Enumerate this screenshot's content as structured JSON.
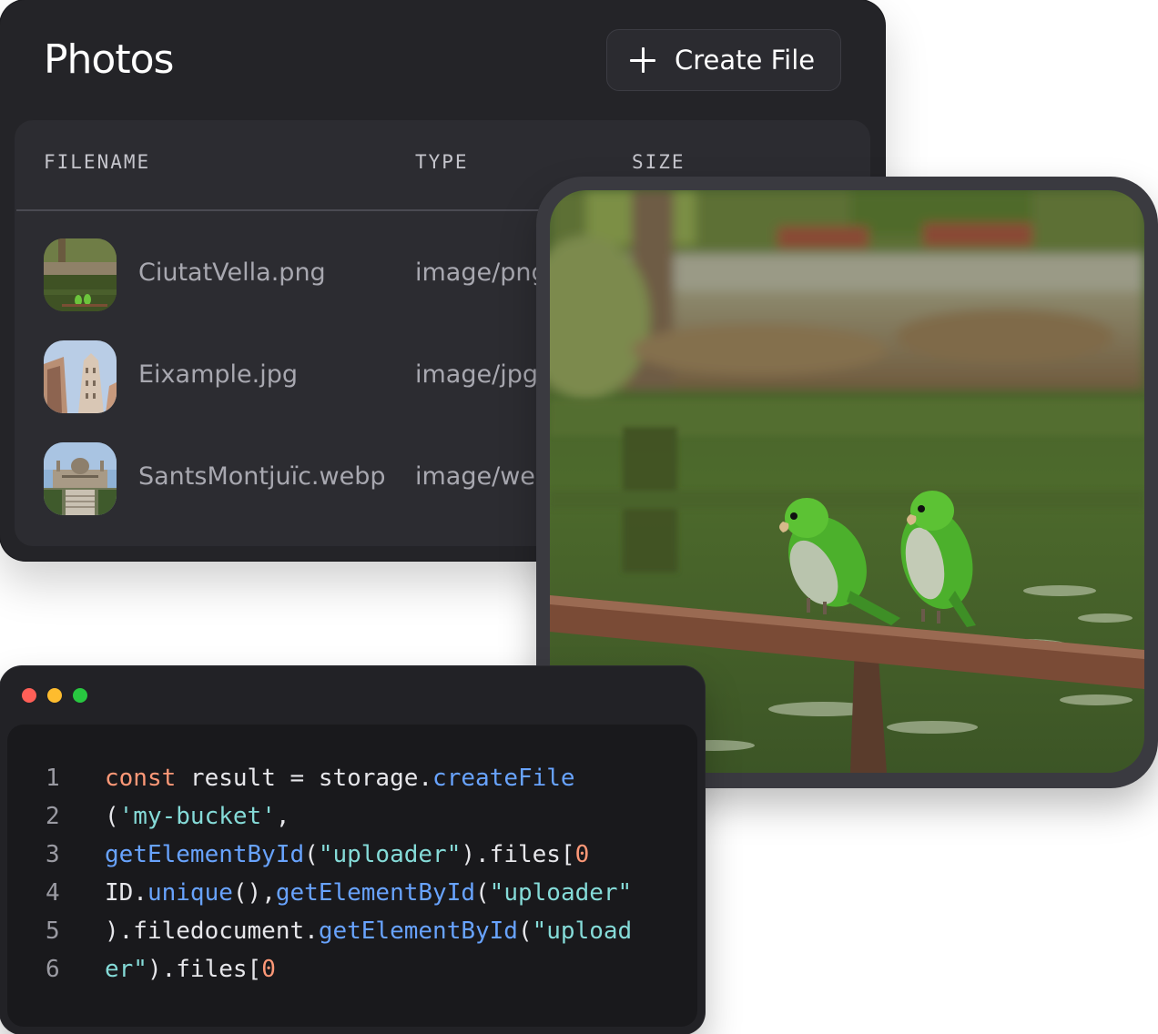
{
  "photos_panel": {
    "title": "Photos",
    "create_button_label": "Create File",
    "columns": [
      "FILENAME",
      "TYPE",
      "SIZE"
    ],
    "rows": [
      {
        "filename": "CiutatVella.png",
        "type": "image/png"
      },
      {
        "filename": "Eixample.jpg",
        "type": "image/jpg"
      },
      {
        "filename": "SantsMontjuïc.webp",
        "type": "image/webp"
      }
    ]
  },
  "code_window": {
    "lines": [
      {
        "number": "1",
        "tokens": [
          {
            "t": "const",
            "k": "kw"
          },
          {
            "t": " result = storage.",
            "k": "plain"
          },
          {
            "t": "createFile",
            "k": "fn"
          }
        ]
      },
      {
        "number": "2",
        "tokens": [
          {
            "t": "(",
            "k": "plain"
          },
          {
            "t": "'my-bucket'",
            "k": "str"
          },
          {
            "t": ",",
            "k": "plain"
          }
        ]
      },
      {
        "number": "3",
        "tokens": [
          {
            "t": "getElementById",
            "k": "fn"
          },
          {
            "t": "(",
            "k": "plain"
          },
          {
            "t": "\"uploader\"",
            "k": "str"
          },
          {
            "t": ").files[",
            "k": "plain"
          },
          {
            "t": "0",
            "k": "num"
          }
        ]
      },
      {
        "number": "4",
        "tokens": [
          {
            "t": "ID.",
            "k": "plain"
          },
          {
            "t": "unique",
            "k": "fn"
          },
          {
            "t": "(),",
            "k": "plain"
          },
          {
            "t": "getElementById",
            "k": "fn"
          },
          {
            "t": "(",
            "k": "plain"
          },
          {
            "t": "\"uploader\"",
            "k": "str"
          }
        ]
      },
      {
        "number": "5",
        "tokens": [
          {
            "t": ").filedocument.",
            "k": "plain"
          },
          {
            "t": "getElementById",
            "k": "fn"
          },
          {
            "t": "(",
            "k": "plain"
          },
          {
            "t": "\"upload",
            "k": "str"
          }
        ]
      },
      {
        "number": "6",
        "tokens": [
          {
            "t": "er\"",
            "k": "str"
          },
          {
            "t": ").files[",
            "k": "plain"
          },
          {
            "t": "0",
            "k": "num"
          }
        ]
      }
    ]
  },
  "colors": {
    "panel_bg": "#242428",
    "card_bg": "#2c2c31",
    "code_keyword": "#fe9877",
    "code_function": "#68a3fe",
    "code_string": "#85dbd8",
    "window_red": "#ff5f57",
    "window_yellow": "#febc2e",
    "window_green": "#28c840"
  },
  "icons": {
    "create_button": "plus-icon"
  }
}
